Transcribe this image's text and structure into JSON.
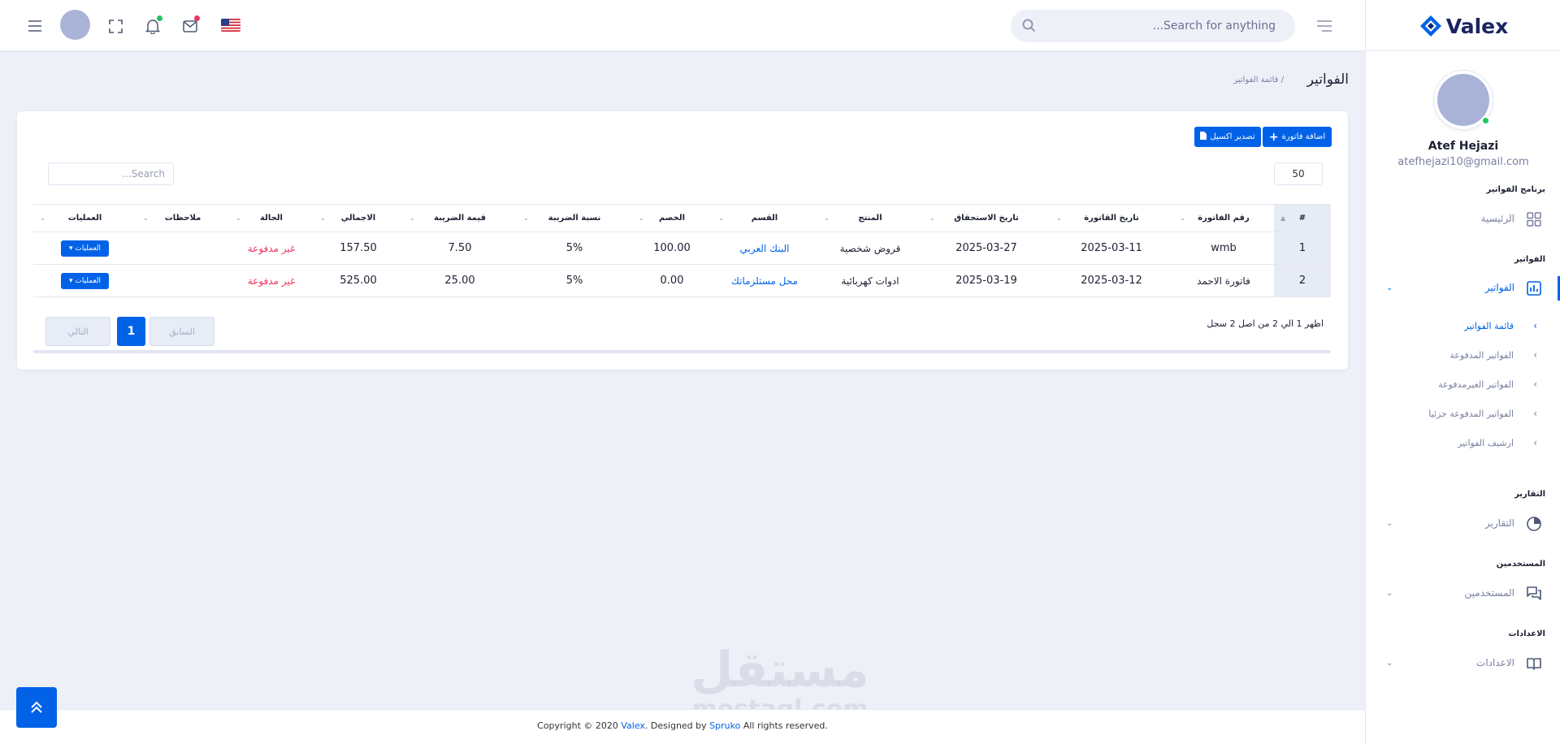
{
  "brand": {
    "name": "Valex"
  },
  "header": {
    "search_placeholder": "Search for anything..."
  },
  "profile": {
    "name": "Atef Hejazi",
    "email": "atefhejazi10@gmail.com"
  },
  "sidebar": {
    "cat_program": "برنامج الفواتير",
    "home": "الرئيسية",
    "cat_invoices": "الفواتير",
    "invoices": "الفواتير",
    "sub": [
      "قائمة الفواتير",
      "الفواتير المدفوعة",
      "الفواتير الغيرمدفوعة",
      "الفواتير المدفوعة جزئيا",
      "ارشيف الفواتير"
    ],
    "cat_reports": "التقارير",
    "reports": "التقارير",
    "cat_users": "المستخدمين",
    "users": "المستخدمين",
    "cat_settings": "الاعدادات",
    "settings": "الاعدادات"
  },
  "page": {
    "title": "الفواتير",
    "breadcrumb": "/ قائمة الفواتير"
  },
  "toolbar": {
    "add_label": "اضافة فاتورة",
    "export_label": "تصدير اكسيل",
    "page_length": "50",
    "search_placeholder": "Search..."
  },
  "table": {
    "headers": [
      "#",
      "رقم الفاتورة",
      "تاريخ القاتورة",
      "تاريخ الاستحقاق",
      "المنتج",
      "القسم",
      "الخصم",
      "نسبة الضريبة",
      "قيمة الضريبة",
      "الاجمالي",
      "الحالة",
      "ملاحظات",
      "العمليات"
    ],
    "rows": [
      {
        "id": "1",
        "number": "wmb",
        "date": "2025-03-11",
        "due": "2025-03-27",
        "product": "قروض شخصية",
        "section": "البنك العربي",
        "discount": "100.00",
        "rate": "5%",
        "tax": "7.50",
        "total": "157.50",
        "status": "غير مدفوعة",
        "notes": "",
        "ops": "العمليات"
      },
      {
        "id": "2",
        "number": "فاتورة الاحمد",
        "date": "2025-03-12",
        "due": "2025-03-19",
        "product": "ادوات كهربائية",
        "section": "محل مستلزماتك",
        "discount": "0.00",
        "rate": "5%",
        "tax": "25.00",
        "total": "525.00",
        "status": "غير مدفوعة",
        "notes": "",
        "ops": "العمليات"
      }
    ]
  },
  "pagination": {
    "info": "اظهر 1 الي 2 من اصل 2 سجل",
    "prev": "السابق",
    "current": "1",
    "next": "التالي"
  },
  "footer": {
    "pre": "Copyright © 2020 ",
    "brand": "Valex",
    "mid": ". Designed by ",
    "by": "Spruko",
    "post": " All rights reserved."
  },
  "watermark": {
    "line1": "مستقل",
    "line2": "mostaql.com"
  },
  "colors": {
    "primary": "#0162e8",
    "danger": "#ee335e",
    "bg": "#eef0f8"
  }
}
